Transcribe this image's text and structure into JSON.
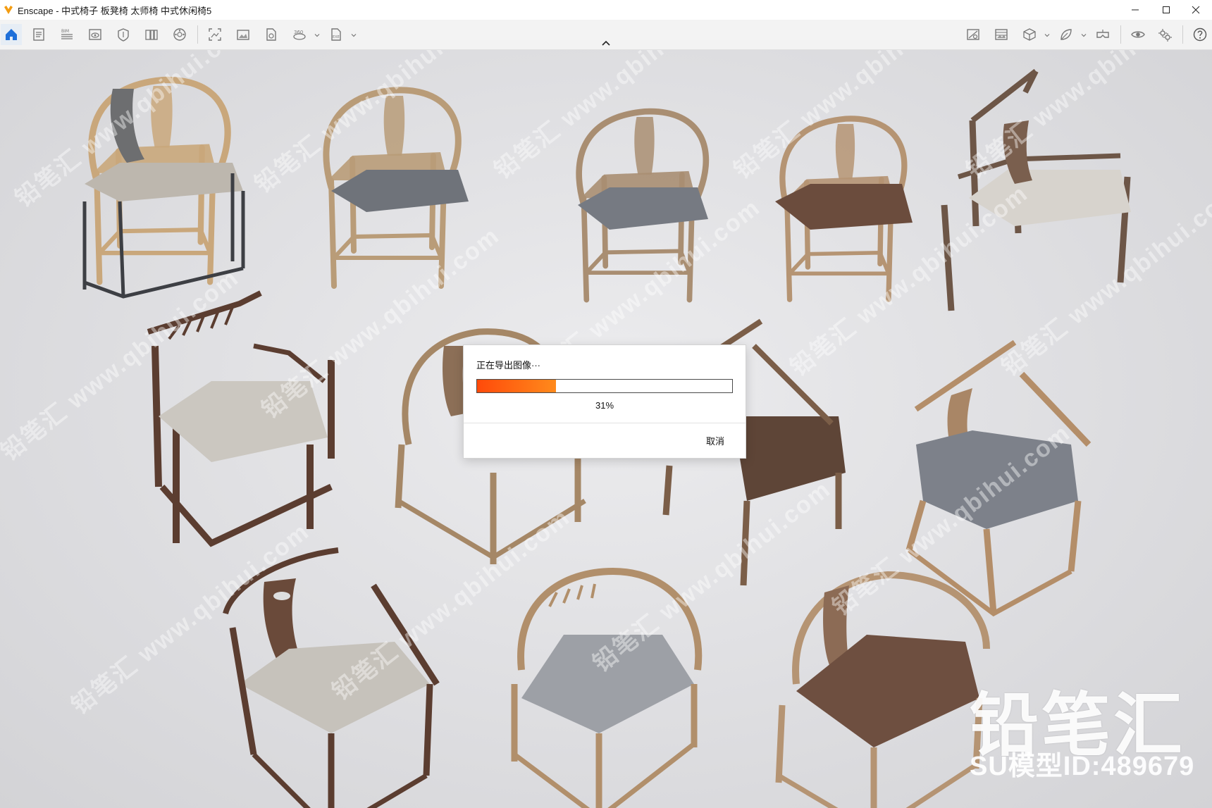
{
  "window": {
    "title": "Enscape - 中式椅子 板凳椅 太师椅 中式休闲椅5"
  },
  "toolbar": {
    "left_icons": [
      "home-icon",
      "documents-icon",
      "bim-icon",
      "view-icon",
      "site-context-icon",
      "asset-library-icon",
      "material-editor-icon",
      "screenshot-icon",
      "batch-render-icon",
      "document-export-icon",
      "panorama-360-icon",
      "standalone-exe-icon"
    ],
    "right_icons": [
      "safe-frame-icon",
      "image-compare-icon",
      "orthographic-icon",
      "atmosphere-icon",
      "vr-headset-icon",
      "visibility-icon",
      "settings-icon",
      "help-icon"
    ]
  },
  "dialog": {
    "title": "正在导出图像···",
    "progress": 31,
    "percent_label": "31%",
    "cancel_label": "取消"
  },
  "watermark": {
    "brand": "铅笔汇",
    "model_id": "SU模型ID:489679",
    "tile_text": "铅笔汇 www.qbihui.com"
  },
  "colors": {
    "progress_start": "#ff4a0a",
    "progress_end": "#ff8a1c",
    "home_accent": "#1e6fd9",
    "app_icon": "#f39c12"
  }
}
